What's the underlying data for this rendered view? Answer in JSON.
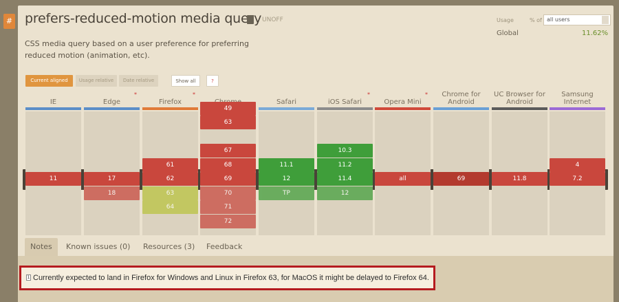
{
  "feature": {
    "title": "prefers-reduced-motion media query",
    "status": "UNOFF",
    "description": "CSS media query based on a user preference for preferring reduced motion (animation, etc)."
  },
  "usage": {
    "label": "Usage",
    "pct_of": "% of",
    "users_select": "all users",
    "global_label": "Global",
    "global_value": "11.62%"
  },
  "controls": {
    "current_aligned": "Current aligned",
    "usage_relative": "Usage relative",
    "date_relative": "Date relative",
    "show_all": "Show all",
    "help": "?"
  },
  "colors": {
    "supported": "#3f9e3a",
    "unsupported": "#c9473d",
    "partial": "#b9c43d",
    "highlight_border": "#b51b1f"
  },
  "browsers": [
    {
      "name": "IE",
      "star": false,
      "line": "#5b8ec8",
      "versions": [
        {
          "v": "11",
          "row": 0,
          "s": "n"
        }
      ]
    },
    {
      "name": "Edge",
      "star": true,
      "line": "#5b8ec8",
      "versions": [
        {
          "v": "17",
          "row": 0,
          "s": "n"
        },
        {
          "v": "18",
          "row": 1,
          "s": "n"
        }
      ]
    },
    {
      "name": "Firefox",
      "star": true,
      "line": "#e07a38",
      "versions": [
        {
          "v": "61",
          "row": -1,
          "s": "n"
        },
        {
          "v": "62",
          "row": 0,
          "s": "n"
        },
        {
          "v": "63",
          "row": 1,
          "s": "p"
        },
        {
          "v": "64",
          "row": 2,
          "s": "p"
        }
      ]
    },
    {
      "name": "Chrome",
      "star": false,
      "line": "#4d8ad5",
      "versions": [
        {
          "v": "49",
          "row": -5,
          "s": "n"
        },
        {
          "v": "63",
          "row": -4,
          "s": "n"
        },
        {
          "v": "67",
          "row": -2,
          "s": "n"
        },
        {
          "v": "68",
          "row": -1,
          "s": "n"
        },
        {
          "v": "69",
          "row": 0,
          "s": "n"
        },
        {
          "v": "70",
          "row": 1,
          "s": "n"
        },
        {
          "v": "71",
          "row": 2,
          "s": "n"
        },
        {
          "v": "72",
          "row": 3,
          "s": "n"
        }
      ]
    },
    {
      "name": "Safari",
      "star": false,
      "line": "#7aaad8",
      "versions": [
        {
          "v": "11.1",
          "row": -1,
          "s": "y"
        },
        {
          "v": "12",
          "row": 0,
          "s": "y"
        },
        {
          "v": "TP",
          "row": 1,
          "s": "y"
        }
      ]
    },
    {
      "name": "iOS Safari",
      "star": true,
      "line": "#8c8c8c",
      "versions": [
        {
          "v": "10.3",
          "row": -2,
          "s": "y"
        },
        {
          "v": "11.2",
          "row": -1,
          "s": "y"
        },
        {
          "v": "11.4",
          "row": 0,
          "s": "y"
        },
        {
          "v": "12",
          "row": 1,
          "s": "y"
        }
      ]
    },
    {
      "name": "Opera Mini",
      "star": true,
      "line": "#d04a3a",
      "versions": [
        {
          "v": "all",
          "row": 0,
          "s": "n"
        }
      ]
    },
    {
      "name": "Chrome for Android",
      "star": false,
      "line": "#6aa0d6",
      "versions": [
        {
          "v": "69",
          "row": 0,
          "s": "n"
        }
      ]
    },
    {
      "name": "UC Browser for Android",
      "star": false,
      "line": "#5b5b5b",
      "versions": [
        {
          "v": "11.8",
          "row": 0,
          "s": "n"
        }
      ]
    },
    {
      "name": "Samsung Internet",
      "star": false,
      "line": "#9b6ad6",
      "versions": [
        {
          "v": "4",
          "row": -1,
          "s": "n"
        },
        {
          "v": "7.2",
          "row": 0,
          "s": "n"
        }
      ]
    }
  ],
  "tabs": [
    "Notes",
    "Known issues (0)",
    "Resources (3)",
    "Feedback"
  ],
  "note": {
    "num": "1",
    "text": "Currently expected to land in Firefox for Windows and Linux in Firefox 63, for MacOS it might be delayed to Firefox 64."
  }
}
